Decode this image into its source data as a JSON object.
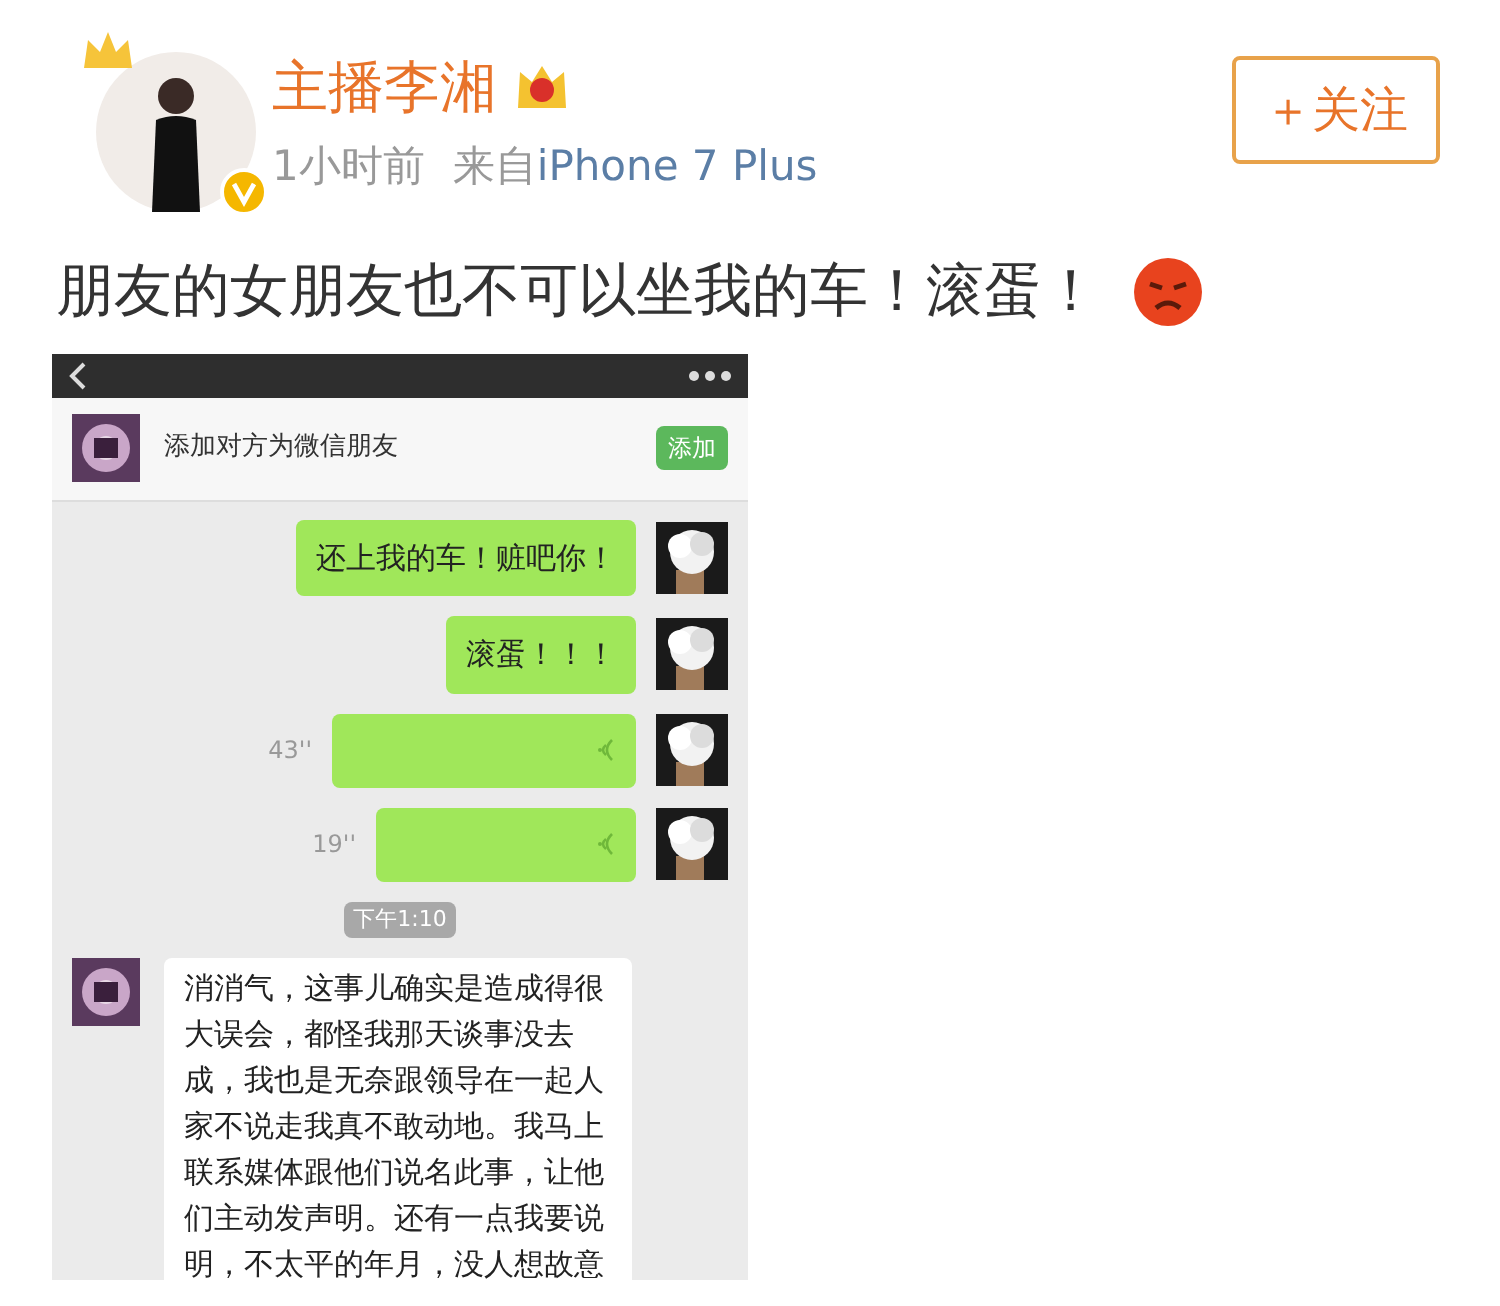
{
  "post": {
    "author": "主播李湘",
    "time": "1小时前",
    "source_prefix": "来自",
    "source": "iPhone 7 Plus",
    "follow_button": "＋关注",
    "text": "朋友的女朋友也不可以坐我的车！滚蛋！"
  },
  "chat_screenshot": {
    "add_friend_bar": {
      "text": "添加对方为微信朋友",
      "button": "添加"
    },
    "messages": [
      {
        "kind": "text",
        "outgoing": true,
        "text": "还上我的车！赃吧你！"
      },
      {
        "kind": "text",
        "outgoing": true,
        "text": "滚蛋！！！"
      },
      {
        "kind": "voice",
        "outgoing": true,
        "duration": "43''"
      },
      {
        "kind": "voice",
        "outgoing": true,
        "duration": "19''"
      },
      {
        "kind": "time",
        "text": "下午1:10"
      },
      {
        "kind": "text",
        "outgoing": false,
        "text": "消消气，这事儿确实是造成得很大误会，都怪我那天谈事没去成，我也是无奈跟领导在一起人家不说走我真不敢动地。我马上联系媒体跟他们说名此事，让他们主动发声明。还有一点我要说明，不太平的年月，没人想故意"
      }
    ]
  }
}
